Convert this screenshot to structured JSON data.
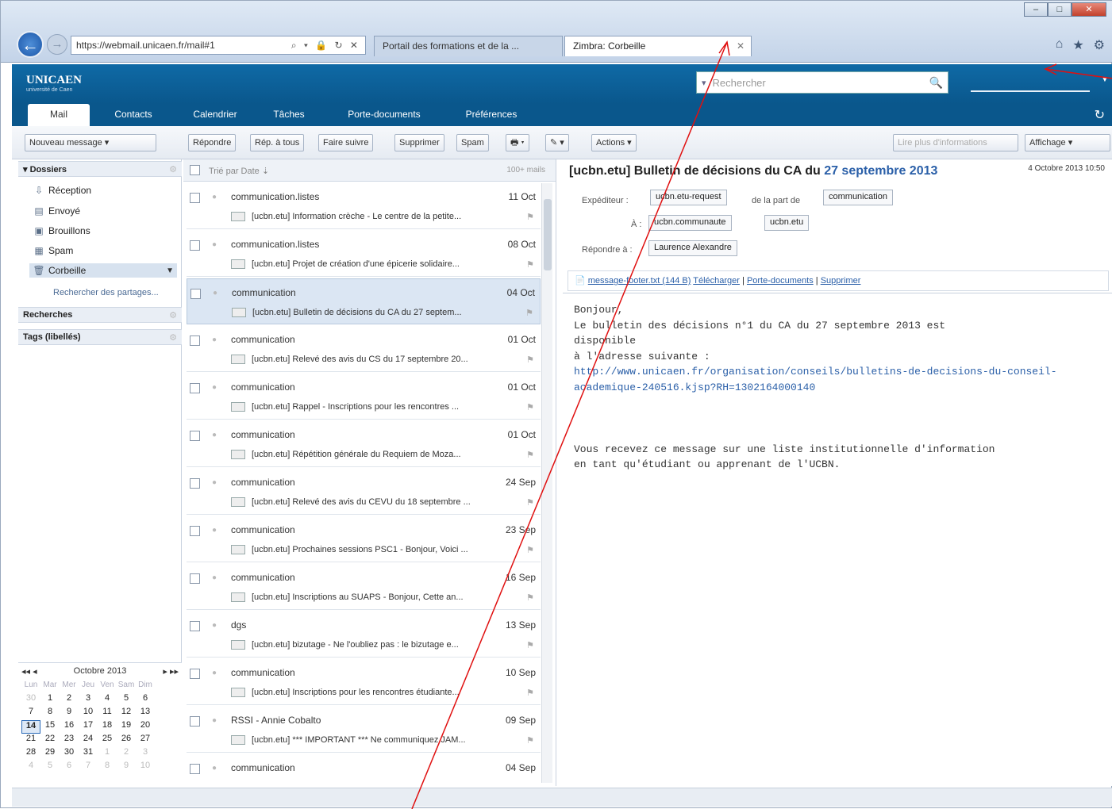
{
  "browser": {
    "window_controls": {
      "minimize": "–",
      "maximize": "□",
      "close": "✕"
    },
    "address": "https://webmail.unicaen.fr/mail#1",
    "address_controls": "⌕ ▾ 🔒 ↻ ✕",
    "tabs": [
      {
        "label": "Portail des formations et de la ..."
      },
      {
        "label": "Zimbra: Corbeille",
        "close": "✕"
      }
    ],
    "toolbar_icons": {
      "home": "⌂",
      "favorites": "★",
      "settings": "⚙"
    }
  },
  "app": {
    "logo": "UNICAEN",
    "logo_sub": "université de Caen",
    "search_placeholder": "Rechercher",
    "search_dropdown": "▾",
    "search_icon": "🔍",
    "tabs": [
      {
        "label": "Mail"
      },
      {
        "label": "Contacts"
      },
      {
        "label": "Calendrier"
      },
      {
        "label": "Tâches"
      },
      {
        "label": "Porte-documents"
      },
      {
        "label": "Préférences"
      }
    ],
    "refresh": "↻"
  },
  "toolbar": {
    "new_message": "Nouveau message ▾",
    "reply": "Répondre",
    "reply_all": "Rép. à tous",
    "forward": "Faire suivre",
    "delete": "Supprimer",
    "spam": "Spam",
    "print": "🖶 ▾",
    "tag": "✎ ▾",
    "actions": "Actions ▾",
    "more_info": "Lire plus d'informations",
    "view": "Affichage ▾"
  },
  "sidebar": {
    "folders_header": "Dossiers",
    "folders": [
      {
        "label": "Réception",
        "icon": "⇩"
      },
      {
        "label": "Envoyé",
        "icon": "▤"
      },
      {
        "label": "Brouillons",
        "icon": "▣"
      },
      {
        "label": "Spam",
        "icon": "▦"
      },
      {
        "label": "Corbeille",
        "icon": "🗑"
      }
    ],
    "search_shares": "Rechercher des partages...",
    "searches_header": "Recherches",
    "tags_header": "Tags (libellés)",
    "gear": "⚙"
  },
  "calendar": {
    "month": "Octobre 2013",
    "prev": "◂◂  ◂",
    "next": "▸  ▸▸",
    "days": [
      "Lun",
      "Mar",
      "Mer",
      "Jeu",
      "Ven",
      "Sam",
      "Dim"
    ],
    "weeks": [
      [
        "30",
        "1",
        "2",
        "3",
        "4",
        "5",
        "6"
      ],
      [
        "7",
        "8",
        "9",
        "10",
        "11",
        "12",
        "13"
      ],
      [
        "14",
        "15",
        "16",
        "17",
        "18",
        "19",
        "20"
      ],
      [
        "21",
        "22",
        "23",
        "24",
        "25",
        "26",
        "27"
      ],
      [
        "28",
        "29",
        "30",
        "31",
        "1",
        "2",
        "3"
      ],
      [
        "4",
        "5",
        "6",
        "7",
        "8",
        "9",
        "10"
      ]
    ]
  },
  "message_list": {
    "sort_label": "Trié par Date ⇣",
    "count": "100+ mails",
    "messages": [
      {
        "from": "communication.listes",
        "date": "11 Oct",
        "subject": "[ucbn.etu] Information crèche - Le centre de la petite..."
      },
      {
        "from": "communication.listes",
        "date": "08 Oct",
        "subject": "[ucbn.etu] Projet de création d'une épicerie solidaire..."
      },
      {
        "from": "communication",
        "date": "04 Oct",
        "subject": "[ucbn.etu] Bulletin de décisions du CA du 27 septem..."
      },
      {
        "from": "communication",
        "date": "01 Oct",
        "subject": "[ucbn.etu] Relevé des avis du CS du 17 septembre 20..."
      },
      {
        "from": "communication",
        "date": "01 Oct",
        "subject": "[ucbn.etu] Rappel - Inscriptions pour les rencontres ..."
      },
      {
        "from": "communication",
        "date": "01 Oct",
        "subject": "[ucbn.etu] Répétition générale du Requiem de Moza..."
      },
      {
        "from": "communication",
        "date": "24 Sep",
        "subject": "[ucbn.etu] Relevé des avis du CEVU du 18 septembre ..."
      },
      {
        "from": "communication",
        "date": "23 Sep",
        "subject": "[ucbn.etu] Prochaines sessions PSC1 - Bonjour, Voici ..."
      },
      {
        "from": "communication",
        "date": "16 Sep",
        "subject": "[ucbn.etu] Inscriptions au SUAPS - Bonjour, Cette an..."
      },
      {
        "from": "dgs",
        "date": "13 Sep",
        "subject": "[ucbn.etu] bizutage - Ne l'oubliez pas : le bizutage e..."
      },
      {
        "from": "communication",
        "date": "10 Sep",
        "subject": "[ucbn.etu] Inscriptions pour les rencontres étudiante..."
      },
      {
        "from": "RSSI - Annie Cobalto",
        "date": "09 Sep",
        "subject": "[ucbn.etu] *** IMPORTANT *** Ne communiquez JAM..."
      },
      {
        "from": "communication",
        "date": "04 Sep",
        "subject": ""
      }
    ]
  },
  "reading": {
    "subject_prefix": "[ucbn.etu] Bulletin de décisions du CA du ",
    "subject_highlight": "27 septembre 2013",
    "date": "4 Octobre 2013 10:50",
    "from_label": "Expéditeur :",
    "from": "ucbn.etu-request",
    "on_behalf_label": "de la part de",
    "on_behalf": "communication",
    "to_label": "À :",
    "to": [
      "ucbn.communaute",
      "ucbn.etu"
    ],
    "reply_to_label": "Répondre à :",
    "reply_to": "Laurence Alexandre",
    "attachment_name": "message-footer.txt (144 B)",
    "attachment_download": "Télécharger",
    "attachment_briefcase": "Porte-documents",
    "attachment_delete": "Supprimer",
    "body_lines": [
      "Bonjour,",
      "Le bulletin des décisions n°1 du CA du 27 septembre 2013 est",
      "disponible",
      "à l'adresse suivante :"
    ],
    "body_link": "http://www.unicaen.fr/organisation/conseils/bulletins-de-decisions-du-conseil-academique-240516.kjsp?RH=1302164000140",
    "body_footer": "Vous recevez ce message sur une liste institutionnelle d'information\nen tant qu'étudiant ou apprenant de l'UCBN."
  },
  "colors": {
    "brand": "#0a578c",
    "link": "#2a5fa8",
    "annotation": "#e01010"
  }
}
